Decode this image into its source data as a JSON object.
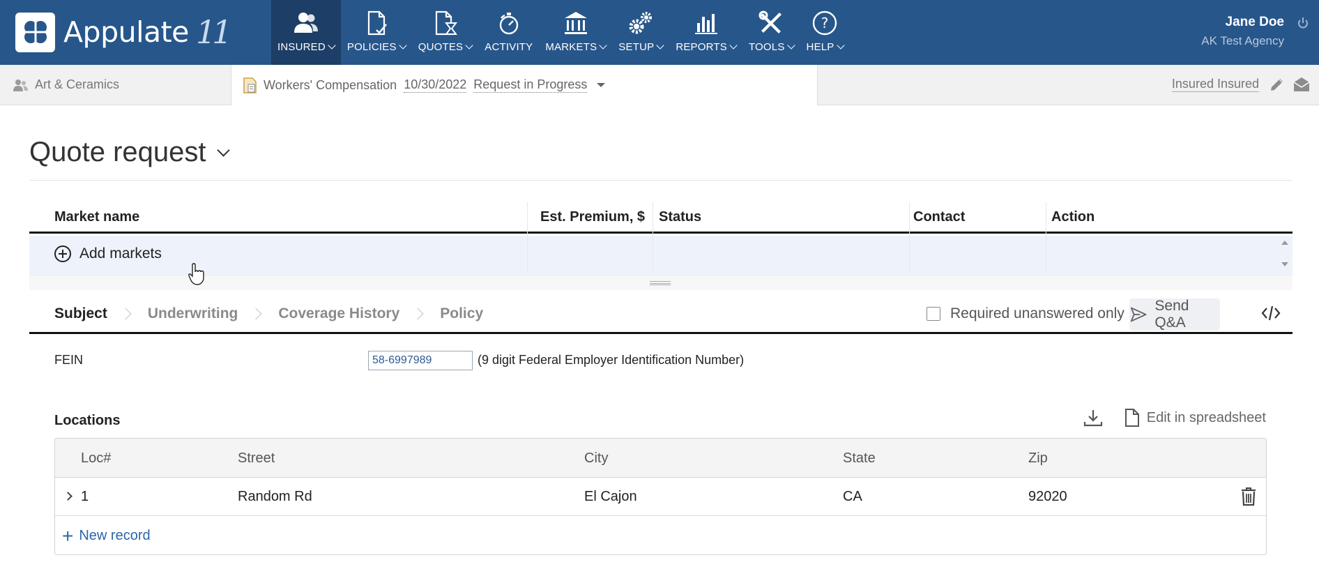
{
  "app": {
    "logo_text": "Appulate",
    "logo_version": "11"
  },
  "nav": [
    {
      "label": "INSURED",
      "icon": "user-group-icon",
      "active": true
    },
    {
      "label": "POLICIES",
      "icon": "document-check-icon"
    },
    {
      "label": "QUOTES",
      "icon": "hourglass-document-icon"
    },
    {
      "label": "ACTIVITY",
      "icon": "stopwatch-icon"
    },
    {
      "label": "MARKETS",
      "icon": "bank-building-icon"
    },
    {
      "label": "SETUP",
      "icon": "gears-icon"
    },
    {
      "label": "REPORTS",
      "icon": "bar-chart-icon"
    },
    {
      "label": "TOOLS",
      "icon": "wrench-screwdriver-icon"
    },
    {
      "label": "HELP",
      "icon": "question-circle-icon"
    }
  ],
  "user": {
    "name": "Jane Doe",
    "agency": "AK Test Agency"
  },
  "context": {
    "insured": "Art & Ceramics",
    "policy_type": "Workers' Compensation",
    "date": "10/30/2022",
    "status": "Request in Progress",
    "assignee": "Insured Insured"
  },
  "page": {
    "title": "Quote request"
  },
  "markets_table": {
    "columns": [
      "Market name",
      "Est. Premium, $",
      "Status",
      "Contact",
      "Action"
    ],
    "add_label": "Add markets"
  },
  "qa": {
    "steps": [
      "Subject",
      "Underwriting",
      "Coverage History",
      "Policy"
    ],
    "active_step": "Subject",
    "required_only_label": "Required unanswered only",
    "required_only_checked": false,
    "send_label": "Send Q&A"
  },
  "fein": {
    "label": "FEIN",
    "value": "58-6997989",
    "hint": "(9 digit Federal Employer Identification Number)"
  },
  "locations": {
    "title": "Locations",
    "edit_label": "Edit in spreadsheet",
    "columns": [
      "Loc#",
      "Street",
      "City",
      "State",
      "Zip"
    ],
    "rows": [
      {
        "loc": "1",
        "street": "Random Rd",
        "city": "El Cajon",
        "state": "CA",
        "zip": "92020"
      }
    ],
    "new_record_label": "New record"
  },
  "colors": {
    "nav_bg": "#27568a",
    "nav_active_bg": "#1d3e66",
    "link_blue": "#2b66a8",
    "row_highlight": "#eef3fb"
  }
}
